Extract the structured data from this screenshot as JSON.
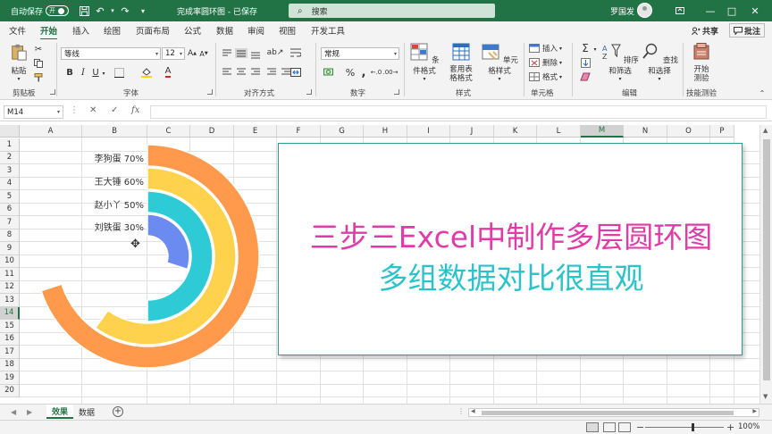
{
  "titlebar": {
    "autosave_label": "自动保存",
    "autosave_state": "开",
    "document": "完成率圆环图 - 已保存",
    "search_placeholder": "搜索",
    "user": "罗国发"
  },
  "tabs": [
    "文件",
    "开始",
    "插入",
    "绘图",
    "页面布局",
    "公式",
    "数据",
    "审阅",
    "视图",
    "开发工具"
  ],
  "active_tab": "开始",
  "share_label": "共享",
  "comment_label": "批注",
  "ribbon": {
    "paste_label": "粘贴",
    "clipboard_label": "剪贴板",
    "font_name": "等线",
    "font_size": "12",
    "font_label": "字体",
    "alignment_label": "对齐方式",
    "number_format": "常规",
    "number_label": "数字",
    "conditional_label": "条件格式",
    "table_format_label": "套用表格格式",
    "cell_style_label": "单元格样式",
    "styles_label": "样式",
    "insert_label": "插入",
    "delete_label": "删除",
    "format_label": "格式",
    "cells_label": "单元格",
    "sort_label": "排序和筛选",
    "find_label": "查找和选择",
    "editing_label": "编辑",
    "test_label": "开始测验",
    "skill_label": "技能测验"
  },
  "namebox": "M14",
  "columns": [
    "A",
    "B",
    "C",
    "D",
    "E",
    "F",
    "G",
    "H",
    "I",
    "J",
    "K",
    "L",
    "M",
    "N",
    "O",
    "P"
  ],
  "selected_column": "M",
  "rows": [
    "1",
    "2",
    "3",
    "4",
    "5",
    "6",
    "7",
    "8",
    "9",
    "10",
    "11",
    "12",
    "13",
    "14",
    "15",
    "16",
    "17",
    "18",
    "19",
    "20"
  ],
  "selected_row": "14",
  "ring_labels": [
    "李狗蛋 70%",
    "王大锤 60%",
    "赵小丫 50%",
    "刘铁蛋 30%"
  ],
  "ring_values": [
    0.7,
    0.6,
    0.5,
    0.3
  ],
  "ring_colors": [
    "#ff9a4c",
    "#ffd24d",
    "#2ecad6",
    "#6b8bf0"
  ],
  "textbox": {
    "line1": "三步三Excel中制作多层圆环图",
    "line2": "多组数据对比很直观"
  },
  "sheets": [
    "效果",
    "数据"
  ],
  "active_sheet": "效果",
  "zoom": "100%"
}
